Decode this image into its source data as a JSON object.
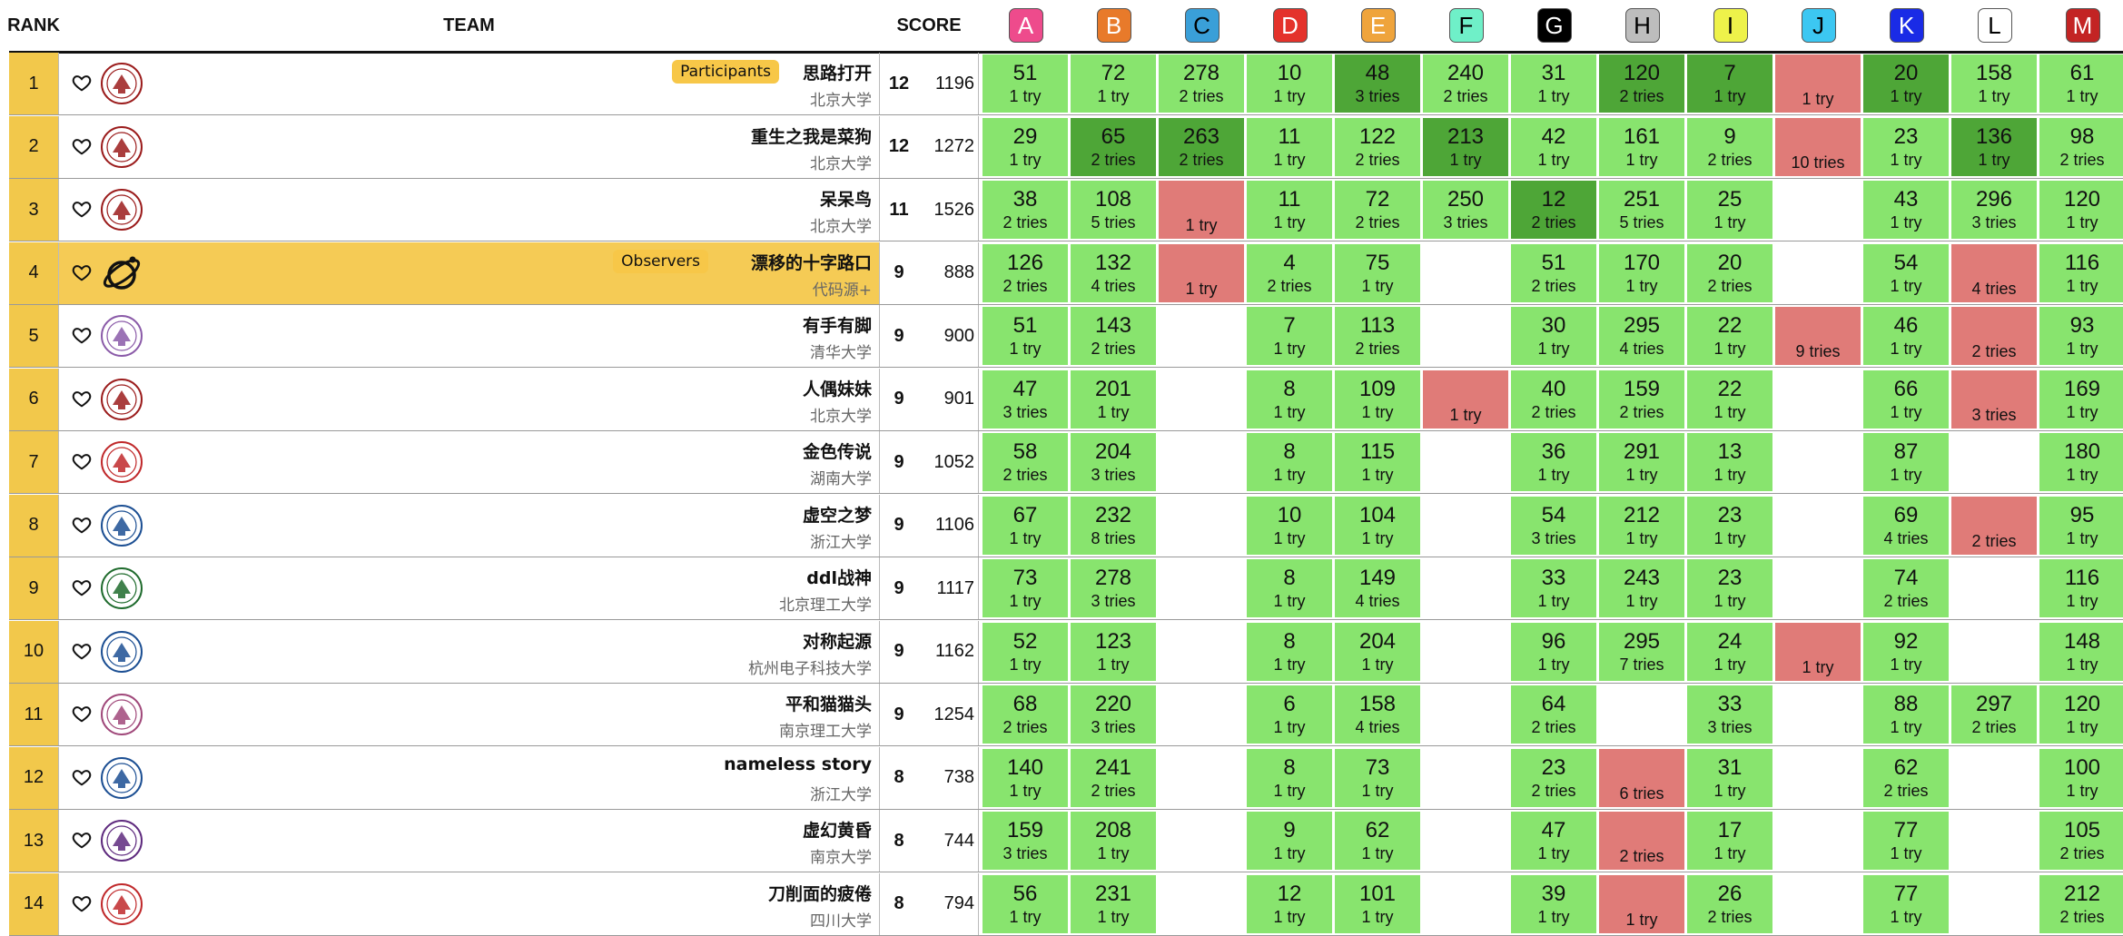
{
  "header": {
    "rank": "RANK",
    "team": "TEAM",
    "score": "SCORE"
  },
  "tags": {
    "participants": "Participants",
    "observers": "Observers"
  },
  "problems": [
    {
      "letter": "A",
      "color": "#ee4b8c",
      "fg": "#ffffff"
    },
    {
      "letter": "B",
      "color": "#e87a2a",
      "fg": "#ffffff"
    },
    {
      "letter": "C",
      "color": "#3a9fd8",
      "fg": "#000000"
    },
    {
      "letter": "D",
      "color": "#e4322b",
      "fg": "#ffffff"
    },
    {
      "letter": "E",
      "color": "#efa43c",
      "fg": "#ffffff"
    },
    {
      "letter": "F",
      "color": "#6ff0c8",
      "fg": "#000000"
    },
    {
      "letter": "G",
      "color": "#000000",
      "fg": "#ffffff"
    },
    {
      "letter": "H",
      "color": "#bdbdbd",
      "fg": "#000000"
    },
    {
      "letter": "I",
      "color": "#eef24a",
      "fg": "#000000"
    },
    {
      "letter": "J",
      "color": "#3cc7f2",
      "fg": "#000000"
    },
    {
      "letter": "K",
      "color": "#1a2be6",
      "fg": "#ffffff"
    },
    {
      "letter": "L",
      "color": "#ffffff",
      "fg": "#000000"
    },
    {
      "letter": "M",
      "color": "#c32424",
      "fg": "#ffffff"
    }
  ],
  "rows": [
    {
      "rank": "1",
      "name": "思路打开",
      "school": "北京大学",
      "solved": "12",
      "penalty": "1196",
      "tag": "participants",
      "observer": false,
      "logo": "pku-logo",
      "logoColor": "#9b1c1c",
      "cells": [
        [
          "ac",
          "51",
          "1 try"
        ],
        [
          "ac",
          "72",
          "1 try"
        ],
        [
          "ac",
          "278",
          "2 tries"
        ],
        [
          "ac",
          "10",
          "1 try"
        ],
        [
          "fb",
          "48",
          "3 tries"
        ],
        [
          "ac",
          "240",
          "2 tries"
        ],
        [
          "ac",
          "31",
          "1 try"
        ],
        [
          "fb",
          "120",
          "2 tries"
        ],
        [
          "fb",
          "7",
          "1 try"
        ],
        [
          "rj",
          "",
          "1 try"
        ],
        [
          "fb",
          "20",
          "1 try"
        ],
        [
          "ac",
          "158",
          "1 try"
        ],
        [
          "ac",
          "61",
          "1 try"
        ]
      ]
    },
    {
      "rank": "2",
      "name": "重生之我是菜狗",
      "school": "北京大学",
      "solved": "12",
      "penalty": "1272",
      "tag": "",
      "observer": false,
      "logo": "pku-logo",
      "logoColor": "#9b1c1c",
      "cells": [
        [
          "ac",
          "29",
          "1 try"
        ],
        [
          "fb",
          "65",
          "2 tries"
        ],
        [
          "fb",
          "263",
          "2 tries"
        ],
        [
          "ac",
          "11",
          "1 try"
        ],
        [
          "ac",
          "122",
          "2 tries"
        ],
        [
          "fb",
          "213",
          "1 try"
        ],
        [
          "ac",
          "42",
          "1 try"
        ],
        [
          "ac",
          "161",
          "1 try"
        ],
        [
          "ac",
          "9",
          "2 tries"
        ],
        [
          "rj",
          "",
          "10 tries"
        ],
        [
          "ac",
          "23",
          "1 try"
        ],
        [
          "fb",
          "136",
          "1 try"
        ],
        [
          "ac",
          "98",
          "2 tries"
        ]
      ]
    },
    {
      "rank": "3",
      "name": "呆呆鸟",
      "school": "北京大学",
      "solved": "11",
      "penalty": "1526",
      "tag": "",
      "observer": false,
      "logo": "pku-logo",
      "logoColor": "#9b1c1c",
      "cells": [
        [
          "ac",
          "38",
          "2 tries"
        ],
        [
          "ac",
          "108",
          "5 tries"
        ],
        [
          "rj",
          "",
          "1 try"
        ],
        [
          "ac",
          "11",
          "1 try"
        ],
        [
          "ac",
          "72",
          "2 tries"
        ],
        [
          "ac",
          "250",
          "3 tries"
        ],
        [
          "fb",
          "12",
          "2 tries"
        ],
        [
          "ac",
          "251",
          "5 tries"
        ],
        [
          "ac",
          "25",
          "1 try"
        ],
        [
          "none",
          "",
          ""
        ],
        [
          "ac",
          "43",
          "1 try"
        ],
        [
          "ac",
          "296",
          "3 tries"
        ],
        [
          "ac",
          "120",
          "1 try"
        ]
      ]
    },
    {
      "rank": "4",
      "name": "漂移的十字路口",
      "school": "代码源+",
      "solved": "9",
      "penalty": "888",
      "tag": "observers",
      "observer": true,
      "logo": "orbit-logo",
      "logoColor": "#111111",
      "cells": [
        [
          "ac",
          "126",
          "2 tries"
        ],
        [
          "ac",
          "132",
          "4 tries"
        ],
        [
          "rj",
          "",
          "1 try"
        ],
        [
          "ac",
          "4",
          "2 tries"
        ],
        [
          "ac",
          "75",
          "1 try"
        ],
        [
          "none",
          "",
          ""
        ],
        [
          "ac",
          "51",
          "2 tries"
        ],
        [
          "ac",
          "170",
          "1 try"
        ],
        [
          "ac",
          "20",
          "2 tries"
        ],
        [
          "none",
          "",
          ""
        ],
        [
          "ac",
          "54",
          "1 try"
        ],
        [
          "rj",
          "",
          "4 tries"
        ],
        [
          "ac",
          "116",
          "1 try"
        ]
      ]
    },
    {
      "rank": "5",
      "name": "有手有脚",
      "school": "清华大学",
      "solved": "9",
      "penalty": "900",
      "tag": "",
      "observer": false,
      "logo": "thu-logo",
      "logoColor": "#8a5aa8",
      "cells": [
        [
          "ac",
          "51",
          "1 try"
        ],
        [
          "ac",
          "143",
          "2 tries"
        ],
        [
          "none",
          "",
          ""
        ],
        [
          "ac",
          "7",
          "1 try"
        ],
        [
          "ac",
          "113",
          "2 tries"
        ],
        [
          "none",
          "",
          ""
        ],
        [
          "ac",
          "30",
          "1 try"
        ],
        [
          "ac",
          "295",
          "4 tries"
        ],
        [
          "ac",
          "22",
          "1 try"
        ],
        [
          "rj",
          "",
          "9 tries"
        ],
        [
          "ac",
          "46",
          "1 try"
        ],
        [
          "rj",
          "",
          "2 tries"
        ],
        [
          "ac",
          "93",
          "1 try"
        ]
      ]
    },
    {
      "rank": "6",
      "name": "人偶妹妹",
      "school": "北京大学",
      "solved": "9",
      "penalty": "901",
      "tag": "",
      "observer": false,
      "logo": "pku-logo",
      "logoColor": "#9b1c1c",
      "cells": [
        [
          "ac",
          "47",
          "3 tries"
        ],
        [
          "ac",
          "201",
          "1 try"
        ],
        [
          "none",
          "",
          ""
        ],
        [
          "ac",
          "8",
          "1 try"
        ],
        [
          "ac",
          "109",
          "1 try"
        ],
        [
          "rj",
          "",
          "1 try"
        ],
        [
          "ac",
          "40",
          "2 tries"
        ],
        [
          "ac",
          "159",
          "2 tries"
        ],
        [
          "ac",
          "22",
          "1 try"
        ],
        [
          "none",
          "",
          ""
        ],
        [
          "ac",
          "66",
          "1 try"
        ],
        [
          "rj",
          "",
          "3 tries"
        ],
        [
          "ac",
          "169",
          "1 try"
        ]
      ]
    },
    {
      "rank": "7",
      "name": "金色传说",
      "school": "湖南大学",
      "solved": "9",
      "penalty": "1052",
      "tag": "",
      "observer": false,
      "logo": "hnu-logo",
      "logoColor": "#c0292b",
      "cells": [
        [
          "ac",
          "58",
          "2 tries"
        ],
        [
          "ac",
          "204",
          "3 tries"
        ],
        [
          "none",
          "",
          ""
        ],
        [
          "ac",
          "8",
          "1 try"
        ],
        [
          "ac",
          "115",
          "1 try"
        ],
        [
          "none",
          "",
          ""
        ],
        [
          "ac",
          "36",
          "1 try"
        ],
        [
          "ac",
          "291",
          "1 try"
        ],
        [
          "ac",
          "13",
          "1 try"
        ],
        [
          "none",
          "",
          ""
        ],
        [
          "ac",
          "87",
          "1 try"
        ],
        [
          "none",
          "",
          ""
        ],
        [
          "ac",
          "180",
          "1 try"
        ]
      ]
    },
    {
      "rank": "8",
      "name": "虚空之梦",
      "school": "浙江大学",
      "solved": "9",
      "penalty": "1106",
      "tag": "",
      "observer": false,
      "logo": "zju-logo",
      "logoColor": "#1c4f93",
      "cells": [
        [
          "ac",
          "67",
          "1 try"
        ],
        [
          "ac",
          "232",
          "8 tries"
        ],
        [
          "none",
          "",
          ""
        ],
        [
          "ac",
          "10",
          "1 try"
        ],
        [
          "ac",
          "104",
          "1 try"
        ],
        [
          "none",
          "",
          ""
        ],
        [
          "ac",
          "54",
          "3 tries"
        ],
        [
          "ac",
          "212",
          "1 try"
        ],
        [
          "ac",
          "23",
          "1 try"
        ],
        [
          "none",
          "",
          ""
        ],
        [
          "ac",
          "69",
          "4 tries"
        ],
        [
          "rj",
          "",
          "2 tries"
        ],
        [
          "ac",
          "95",
          "1 try"
        ]
      ]
    },
    {
      "rank": "9",
      "name": "ddl战神",
      "school": "北京理工大学",
      "solved": "9",
      "penalty": "1117",
      "tag": "",
      "observer": false,
      "logo": "bit-logo",
      "logoColor": "#1f6b2d",
      "cells": [
        [
          "ac",
          "73",
          "1 try"
        ],
        [
          "ac",
          "278",
          "3 tries"
        ],
        [
          "none",
          "",
          ""
        ],
        [
          "ac",
          "8",
          "1 try"
        ],
        [
          "ac",
          "149",
          "4 tries"
        ],
        [
          "none",
          "",
          ""
        ],
        [
          "ac",
          "33",
          "1 try"
        ],
        [
          "ac",
          "243",
          "1 try"
        ],
        [
          "ac",
          "23",
          "1 try"
        ],
        [
          "none",
          "",
          ""
        ],
        [
          "ac",
          "74",
          "2 tries"
        ],
        [
          "none",
          "",
          ""
        ],
        [
          "ac",
          "116",
          "1 try"
        ]
      ]
    },
    {
      "rank": "10",
      "name": "对称起源",
      "school": "杭州电子科技大学",
      "solved": "9",
      "penalty": "1162",
      "tag": "",
      "observer": false,
      "logo": "hdu-logo",
      "logoColor": "#1c4f93",
      "cells": [
        [
          "ac",
          "52",
          "1 try"
        ],
        [
          "ac",
          "123",
          "1 try"
        ],
        [
          "none",
          "",
          ""
        ],
        [
          "ac",
          "8",
          "1 try"
        ],
        [
          "ac",
          "204",
          "1 try"
        ],
        [
          "none",
          "",
          ""
        ],
        [
          "ac",
          "96",
          "1 try"
        ],
        [
          "ac",
          "295",
          "7 tries"
        ],
        [
          "ac",
          "24",
          "1 try"
        ],
        [
          "rj",
          "",
          "1 try"
        ],
        [
          "ac",
          "92",
          "1 try"
        ],
        [
          "none",
          "",
          ""
        ],
        [
          "ac",
          "148",
          "1 try"
        ]
      ]
    },
    {
      "rank": "11",
      "name": "平和猫猫头",
      "school": "南京理工大学",
      "solved": "9",
      "penalty": "1254",
      "tag": "",
      "observer": false,
      "logo": "njust-logo",
      "logoColor": "#a0487a",
      "cells": [
        [
          "ac",
          "68",
          "2 tries"
        ],
        [
          "ac",
          "220",
          "3 tries"
        ],
        [
          "none",
          "",
          ""
        ],
        [
          "ac",
          "6",
          "1 try"
        ],
        [
          "ac",
          "158",
          "4 tries"
        ],
        [
          "none",
          "",
          ""
        ],
        [
          "ac",
          "64",
          "2 tries"
        ],
        [
          "none",
          "",
          ""
        ],
        [
          "ac",
          "33",
          "3 tries"
        ],
        [
          "none",
          "",
          ""
        ],
        [
          "ac",
          "88",
          "1 try"
        ],
        [
          "ac",
          "297",
          "2 tries"
        ],
        [
          "ac",
          "120",
          "1 try"
        ]
      ]
    },
    {
      "rank": "12",
      "name": "nameless story",
      "school": "浙江大学",
      "solved": "8",
      "penalty": "738",
      "tag": "",
      "observer": false,
      "logo": "zju-logo",
      "logoColor": "#1c4f93",
      "cells": [
        [
          "ac",
          "140",
          "1 try"
        ],
        [
          "ac",
          "241",
          "2 tries"
        ],
        [
          "none",
          "",
          ""
        ],
        [
          "ac",
          "8",
          "1 try"
        ],
        [
          "ac",
          "73",
          "1 try"
        ],
        [
          "none",
          "",
          ""
        ],
        [
          "ac",
          "23",
          "2 tries"
        ],
        [
          "rj",
          "",
          "6 tries"
        ],
        [
          "ac",
          "31",
          "1 try"
        ],
        [
          "none",
          "",
          ""
        ],
        [
          "ac",
          "62",
          "2 tries"
        ],
        [
          "none",
          "",
          ""
        ],
        [
          "ac",
          "100",
          "1 try"
        ]
      ]
    },
    {
      "rank": "13",
      "name": "虚幻黄昏",
      "school": "南京大学",
      "solved": "8",
      "penalty": "744",
      "tag": "",
      "observer": false,
      "logo": "nju-logo",
      "logoColor": "#5e2a7e",
      "cells": [
        [
          "ac",
          "159",
          "3 tries"
        ],
        [
          "ac",
          "208",
          "1 try"
        ],
        [
          "none",
          "",
          ""
        ],
        [
          "ac",
          "9",
          "1 try"
        ],
        [
          "ac",
          "62",
          "1 try"
        ],
        [
          "none",
          "",
          ""
        ],
        [
          "ac",
          "47",
          "1 try"
        ],
        [
          "rj",
          "",
          "2 tries"
        ],
        [
          "ac",
          "17",
          "1 try"
        ],
        [
          "none",
          "",
          ""
        ],
        [
          "ac",
          "77",
          "1 try"
        ],
        [
          "none",
          "",
          ""
        ],
        [
          "ac",
          "105",
          "2 tries"
        ]
      ]
    },
    {
      "rank": "14",
      "name": "刀削面的疲倦",
      "school": "四川大学",
      "solved": "8",
      "penalty": "794",
      "tag": "",
      "observer": false,
      "logo": "scu-logo",
      "logoColor": "#c0292b",
      "cells": [
        [
          "ac",
          "56",
          "1 try"
        ],
        [
          "ac",
          "231",
          "1 try"
        ],
        [
          "none",
          "",
          ""
        ],
        [
          "ac",
          "12",
          "1 try"
        ],
        [
          "ac",
          "101",
          "1 try"
        ],
        [
          "none",
          "",
          ""
        ],
        [
          "ac",
          "39",
          "1 try"
        ],
        [
          "rj",
          "",
          "1 try"
        ],
        [
          "ac",
          "26",
          "2 tries"
        ],
        [
          "none",
          "",
          ""
        ],
        [
          "ac",
          "77",
          "1 try"
        ],
        [
          "none",
          "",
          ""
        ],
        [
          "ac",
          "212",
          "2 tries"
        ]
      ]
    }
  ]
}
